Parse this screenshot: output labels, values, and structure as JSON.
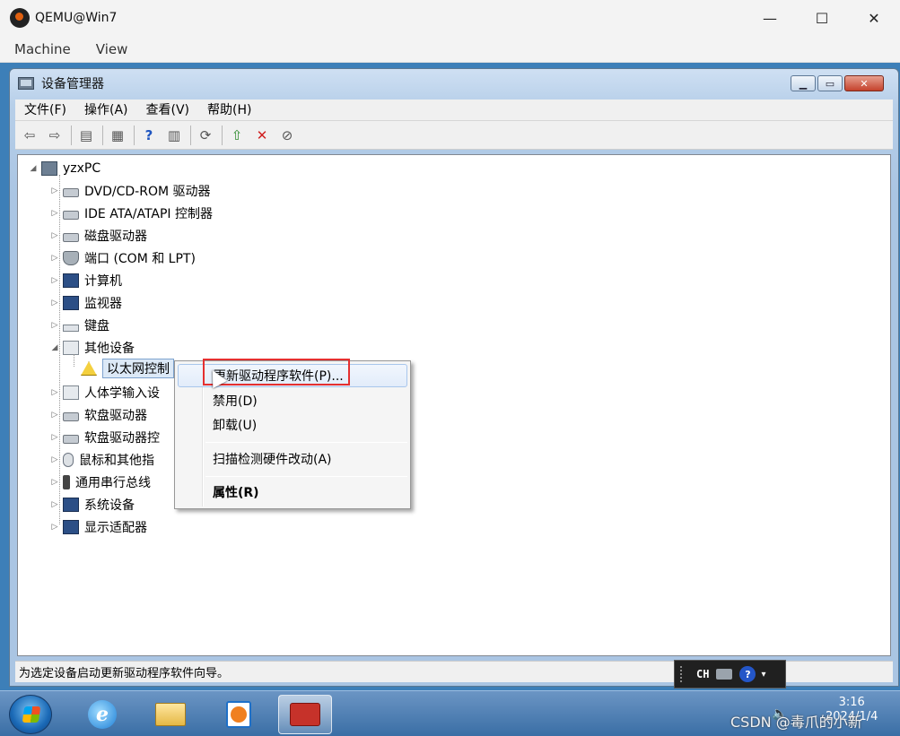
{
  "host": {
    "title": "QEMU@Win7",
    "controls": {
      "minimize": "—",
      "maximize": "☐",
      "close": "✕"
    },
    "menus": [
      "Machine",
      "View"
    ]
  },
  "window": {
    "title": "设备管理器",
    "menus": [
      "文件(F)",
      "操作(A)",
      "查看(V)",
      "帮助(H)"
    ],
    "toolbar_icons": [
      "back-icon",
      "forward-icon",
      "show-hide-tree-icon",
      "properties-icon",
      "help-icon",
      "action-pane-icon",
      "scan-hardware-icon",
      "update-driver-icon",
      "uninstall-icon",
      "disable-icon"
    ]
  },
  "tree": {
    "root": "yzxPC",
    "items": [
      "DVD/CD-ROM 驱动器",
      "IDE ATA/ATAPI 控制器",
      "磁盘驱动器",
      "端口 (COM 和 LPT)",
      "计算机",
      "监视器",
      "键盘",
      "其他设备",
      "以太网控制",
      "人体学输入设",
      "软盘驱动器",
      "软盘驱动器控",
      "鼠标和其他指",
      "通用串行总线",
      "系统设备",
      "显示适配器"
    ]
  },
  "context_menu": {
    "update_driver": "更新驱动程序软件(P)...",
    "disable": "禁用(D)",
    "uninstall": "卸载(U)",
    "scan": "扫描检测硬件改动(A)",
    "properties": "属性(R)"
  },
  "status": {
    "text": "为选定设备启动更新驱动程序软件向导。"
  },
  "langbar": {
    "lang": "CH",
    "help": "?"
  },
  "taskbar": {
    "time": "3:16",
    "date": "2024/1/4",
    "watermark": "CSDN @毒爪的小新"
  },
  "colors": {
    "accent_red": "#e53030",
    "desktop": "#3d7fb8"
  }
}
